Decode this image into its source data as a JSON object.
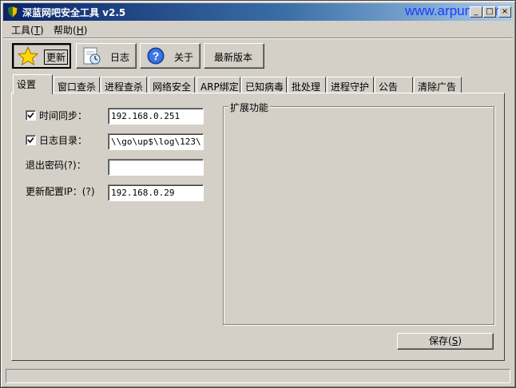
{
  "window": {
    "title": "深蓝网吧安全工具 v2.5",
    "watermark": "www.arpun.com",
    "controls": {
      "minimize": "_",
      "maximize": "□",
      "close": "×"
    }
  },
  "menu": [
    {
      "label": "工具(",
      "key": "T",
      "tail": ")"
    },
    {
      "label": "帮助(",
      "key": "H",
      "tail": ")"
    }
  ],
  "toolbar": {
    "update_label": "更新",
    "log_label": "日志",
    "about_label": "关于",
    "latest_label": "最新版本"
  },
  "tabs": [
    "设置",
    "窗口查杀",
    "进程查杀",
    "网络安全",
    "ARP绑定",
    "已知病毒",
    "批处理",
    "进程守护",
    "公告",
    "清除广告"
  ],
  "settings": {
    "time_sync": {
      "label": "时间同步：",
      "checked": true,
      "value": "192.168.0.251"
    },
    "log_dir": {
      "label": "日志目录：",
      "checked": true,
      "value": "\\\\go\\up$\\log\\123\\"
    },
    "exit_password": {
      "label": "退出密码(?)：",
      "value": ""
    },
    "update_ip": {
      "label": "更新配置IP：(?)",
      "value": "192.168.0.29"
    }
  },
  "extension": {
    "title": "扩展功能"
  },
  "save": {
    "label": "保存(",
    "key": "S",
    "tail": ")"
  },
  "status": {
    "text": ""
  },
  "colors": {
    "title_start": "#0a246a",
    "title_end": "#a6caf0",
    "face": "#d4d0c8",
    "watermark": "#1a3cff"
  },
  "icons": {
    "update": "star-icon",
    "log": "clock-document-icon",
    "about": "question-icon",
    "app": "shield-icon"
  }
}
